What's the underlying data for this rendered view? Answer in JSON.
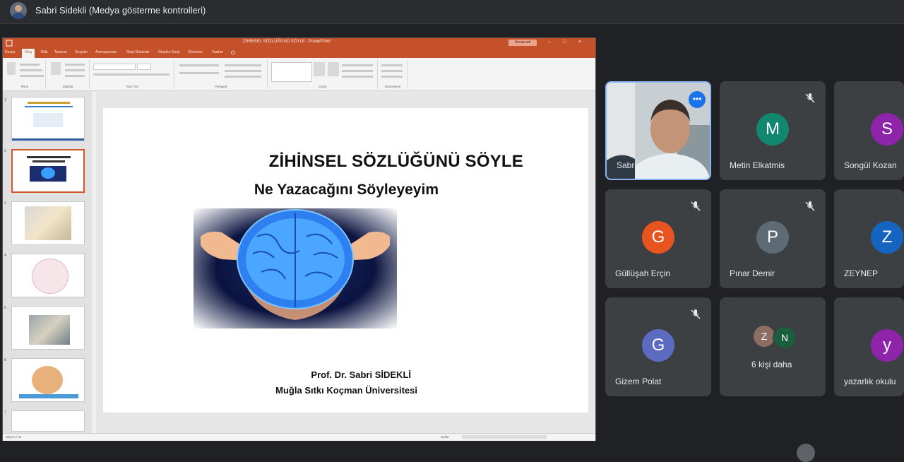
{
  "meet": {
    "presenter_title": "Sabri Sidekli (Medya gösterme kontrolleri)",
    "more_options_icon": "more-horiz-icon",
    "participants": [
      {
        "name": "Sabri Sidekli",
        "type": "video",
        "active": true
      },
      {
        "name": "Metin Elkatmis",
        "initial": "M",
        "color": "#12876f",
        "muted": true
      },
      {
        "name": "Songül Kozan",
        "initial": "S",
        "color": "#8e24aa",
        "muted": false
      },
      {
        "name": "Güllüşah Erçin",
        "initial": "G",
        "color": "#e8541f",
        "muted": true
      },
      {
        "name": "Pınar Demir",
        "initial": "P",
        "color": "#5f6b74",
        "muted": true
      },
      {
        "name": "ZEYNEP",
        "initial": "Z",
        "color": "#1565c0",
        "muted": false
      },
      {
        "name": "Gizem Polat",
        "initial": "G",
        "color": "#5c6bc0",
        "muted": true
      },
      {
        "name": "6 kişi daha",
        "type": "group",
        "mini": [
          {
            "initial": "Z",
            "color": "#8d6e63"
          },
          {
            "initial": "N",
            "color": "#1b5e3b"
          }
        ]
      },
      {
        "name": "yazarlık okulu",
        "initial": "y",
        "color": "#8e24aa",
        "muted": false
      }
    ]
  },
  "powerpoint": {
    "window_title": "ZİHİNSEL SÖZLÜĞÜNÜ SÖYLE - PowerPoint",
    "account": "Hesap adı",
    "tabs": [
      "Dosya",
      "Giriş",
      "Ekle",
      "Tasarım",
      "Geçişler",
      "Animasyonlar",
      "Slayt Gösterisi",
      "Gözden Geçir",
      "Görünüm",
      "Yardım"
    ],
    "active_tab": "Giriş",
    "ribbon_groups": [
      "Pano",
      "Slaytlar",
      "Yazı Tipi",
      "Paragraf",
      "Çizim",
      "Düzenleme"
    ],
    "slide_count": 7,
    "status_left": "Slayt 2 / 31",
    "status_right": "Notlar"
  },
  "slide": {
    "title": "ZİHİNSEL SÖZLÜĞÜNÜ SÖYLE",
    "subtitle": "Ne Yazacağını Söyleyeyim",
    "author": "Prof. Dr. Sabri SİDEKLİ",
    "university": "Muğla Sıtkı Koçman Üniversitesi",
    "image": "brain-in-hands"
  }
}
